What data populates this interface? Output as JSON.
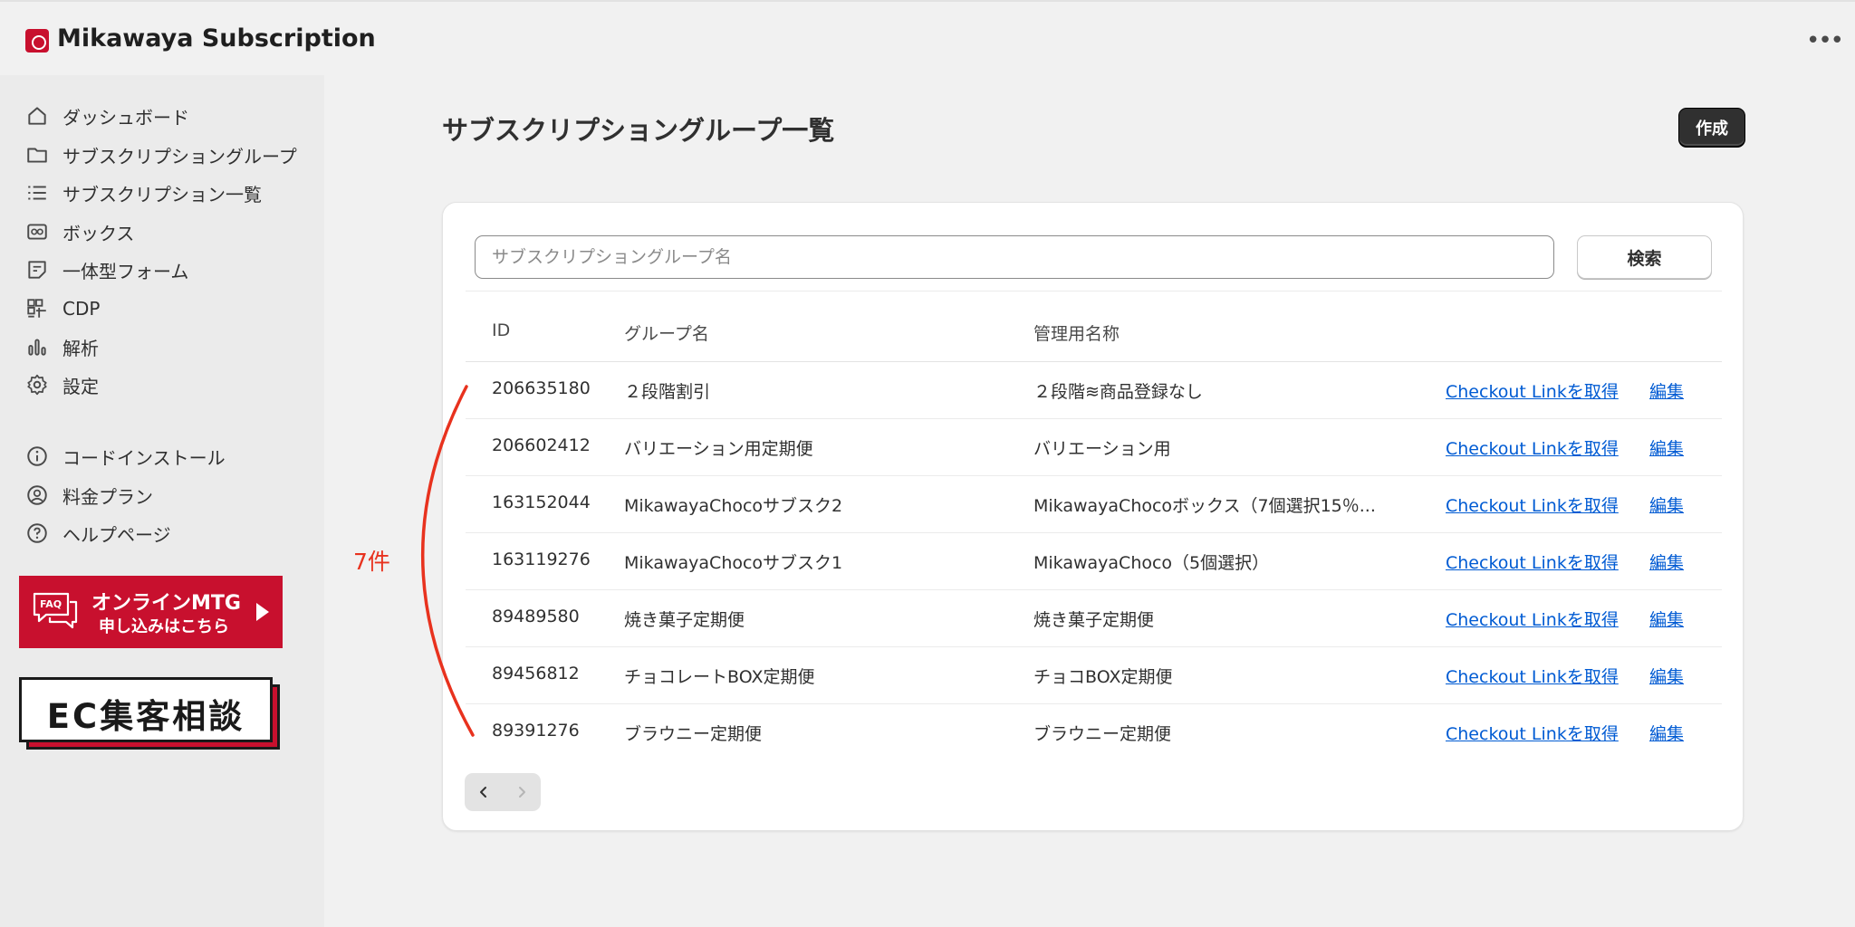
{
  "app": {
    "title": "Mikawaya Subscription",
    "logo_icon": "shopping-bag-icon",
    "more_icon": "ellipsis-icon"
  },
  "sidebar": {
    "items": [
      {
        "label": "ダッシュボード",
        "icon": "home-icon"
      },
      {
        "label": "サブスクリプショングループ",
        "icon": "folder-icon"
      },
      {
        "label": "サブスクリプション一覧",
        "icon": "list-icon"
      },
      {
        "label": "ボックス",
        "icon": "box-icon"
      },
      {
        "label": "一体型フォーム",
        "icon": "form-icon"
      },
      {
        "label": "CDP",
        "icon": "grid-icon"
      },
      {
        "label": "解析",
        "icon": "bar-chart-icon"
      },
      {
        "label": "設定",
        "icon": "gear-icon"
      }
    ],
    "secondary_items": [
      {
        "label": "コードインストール",
        "icon": "info-icon"
      },
      {
        "label": "料金プラン",
        "icon": "user-circle-icon"
      },
      {
        "label": "ヘルプページ",
        "icon": "question-icon"
      }
    ]
  },
  "banners": {
    "mtg": {
      "faq": "FAQ",
      "line1": "オンラインMTG",
      "line2": "申し込みはこちら",
      "color": "#c8102e"
    },
    "ec": {
      "text": "EC集客相談"
    }
  },
  "page": {
    "title": "サブスクリプショングループ一覧",
    "create_label": "作成"
  },
  "search": {
    "placeholder": "サブスクリプショングループ名",
    "value": "",
    "button_label": "検索"
  },
  "table": {
    "headers": {
      "id": "ID",
      "name": "グループ名",
      "admin": "管理用名称"
    },
    "link_label": "Checkout Linkを取得",
    "edit_label": "編集",
    "rows": [
      {
        "id": "206635180",
        "name": "２段階割引",
        "admin": "２段階≋商品登録なし"
      },
      {
        "id": "206602412",
        "name": "バリエーション用定期便",
        "admin": "バリエーション用"
      },
      {
        "id": "163152044",
        "name": "MikawayaChocoサブスク2",
        "admin": "MikawayaChocoボックス（7個選択15％..."
      },
      {
        "id": "163119276",
        "name": "MikawayaChocoサブスク1",
        "admin": "MikawayaChoco（5個選択）"
      },
      {
        "id": "89489580",
        "name": "焼き菓子定期便",
        "admin": "焼き菓子定期便"
      },
      {
        "id": "89456812",
        "name": "チョコレートBOX定期便",
        "admin": "チョコBOX定期便"
      },
      {
        "id": "89391276",
        "name": "ブラウニー定期便",
        "admin": "ブラウニー定期便"
      }
    ]
  },
  "annotation": {
    "count_label": "7件",
    "color": "#e8321e"
  },
  "colors": {
    "link": "#005bd3",
    "primary_button": "#303030"
  }
}
